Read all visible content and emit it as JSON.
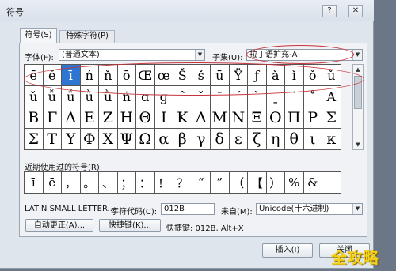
{
  "window": {
    "title": "符号",
    "help_label": "?",
    "close_label": "✕"
  },
  "tabs": [
    {
      "label": "符号(S)"
    },
    {
      "label": "特殊字符(P)"
    }
  ],
  "font": {
    "label": "字体(F):",
    "value": "(普通文本)"
  },
  "subset": {
    "label": "子集(U):",
    "value": "拉丁语扩充-A"
  },
  "grid_rows": [
    [
      "ē",
      "ĕ",
      "ī",
      "ń",
      "ň",
      "ō",
      "Œ",
      "œ",
      "Š",
      "š",
      "ū",
      "Ÿ",
      "ƒ",
      "ǎ",
      "ǐ",
      "ǒ",
      "ǔ"
    ],
    [
      "ǔ",
      "ǚ",
      "ǘ",
      "ǜ",
      "ǜ",
      "ṅ",
      "ɑ",
      "ɡ",
      "ˆ",
      "ˇ",
      "ˉ",
      "ˊ",
      "ˋ",
      "ˍ",
      "˙",
      "˚",
      "Α"
    ],
    [
      "Β",
      "Γ",
      "Δ",
      "Ε",
      "Ζ",
      "Η",
      "Θ",
      "Ι",
      "Κ",
      "Λ",
      "Μ",
      "Ν",
      "Ξ",
      "Ο",
      "Π",
      "Ρ",
      "Σ"
    ],
    [
      "Σ",
      "Τ",
      "Υ",
      "Φ",
      "Χ",
      "Ψ",
      "Ω",
      "α",
      "β",
      "γ",
      "δ",
      "ε",
      "ζ",
      "η",
      "θ",
      "ι",
      "κ"
    ]
  ],
  "recent": {
    "label": "近期使用过的符号(R):",
    "symbols": [
      "ī",
      "ē",
      "，",
      "。",
      "、",
      "；",
      "：",
      "！",
      "？",
      "“",
      "”",
      "（",
      "【",
      "）",
      "%",
      "&"
    ]
  },
  "char_name": "LATIN SMALL LETTER...",
  "char_code": {
    "label": "字符代码(C):",
    "value": "012B"
  },
  "from": {
    "label": "来自(M):",
    "value": "Unicode(十六进制)"
  },
  "buttons": {
    "autocorrect": "自动更正(A)...",
    "shortcut_key": "快捷键(K)...",
    "shortcut_text": "快捷键: 012B, Alt+X",
    "insert": "插入(I)",
    "close": "关闭"
  },
  "scrollbar": {
    "up": "▲",
    "down": "▼"
  },
  "watermark": "全攻略",
  "colors": {
    "selection": "#2e76d0",
    "annotation": "#c8323a",
    "watermark": "#f5d21a"
  }
}
